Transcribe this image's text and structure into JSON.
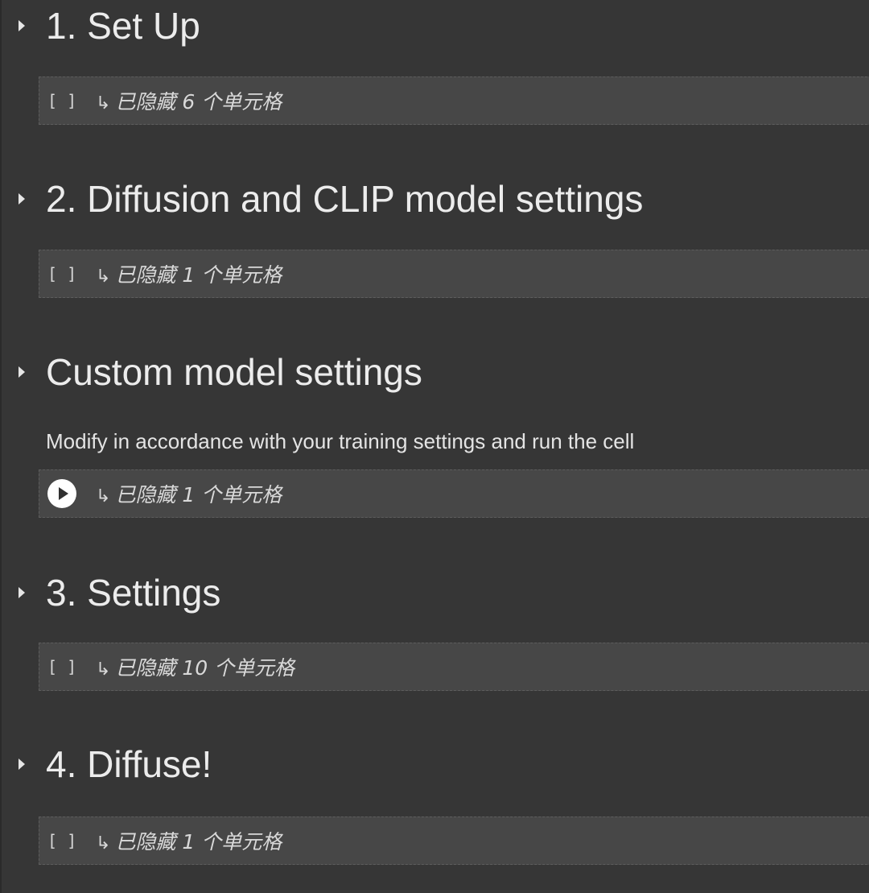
{
  "sections": [
    {
      "title": "1. Set Up",
      "cell": {
        "bracket": "[ ]",
        "info": "已隐藏 6 个单元格",
        "has_run_button": false
      }
    },
    {
      "title": "2. Diffusion and CLIP model settings",
      "cell": {
        "bracket": "[ ]",
        "info": "已隐藏 1 个单元格",
        "has_run_button": false
      }
    },
    {
      "title": "Custom model settings",
      "description": "Modify in accordance with your training settings and run the cell",
      "cell": {
        "bracket": "",
        "info": "已隐藏 1 个单元格",
        "has_run_button": true
      }
    },
    {
      "title": "3. Settings",
      "cell": {
        "bracket": "[ ]",
        "info": "已隐藏 10 个单元格",
        "has_run_button": false
      }
    },
    {
      "title": "4. Diffuse!",
      "cell": {
        "bracket": "[ ]",
        "info": "已隐藏 1 个单元格",
        "has_run_button": false
      }
    }
  ],
  "icons": {
    "toggle": "caret-right-icon",
    "hidden_arrow": "arrow-return-icon",
    "run": "play-icon"
  },
  "glyphs": {
    "hidden_arrow": "↳"
  },
  "colors": {
    "background": "#363636",
    "cell_background": "#474747",
    "text": "#ececec"
  }
}
